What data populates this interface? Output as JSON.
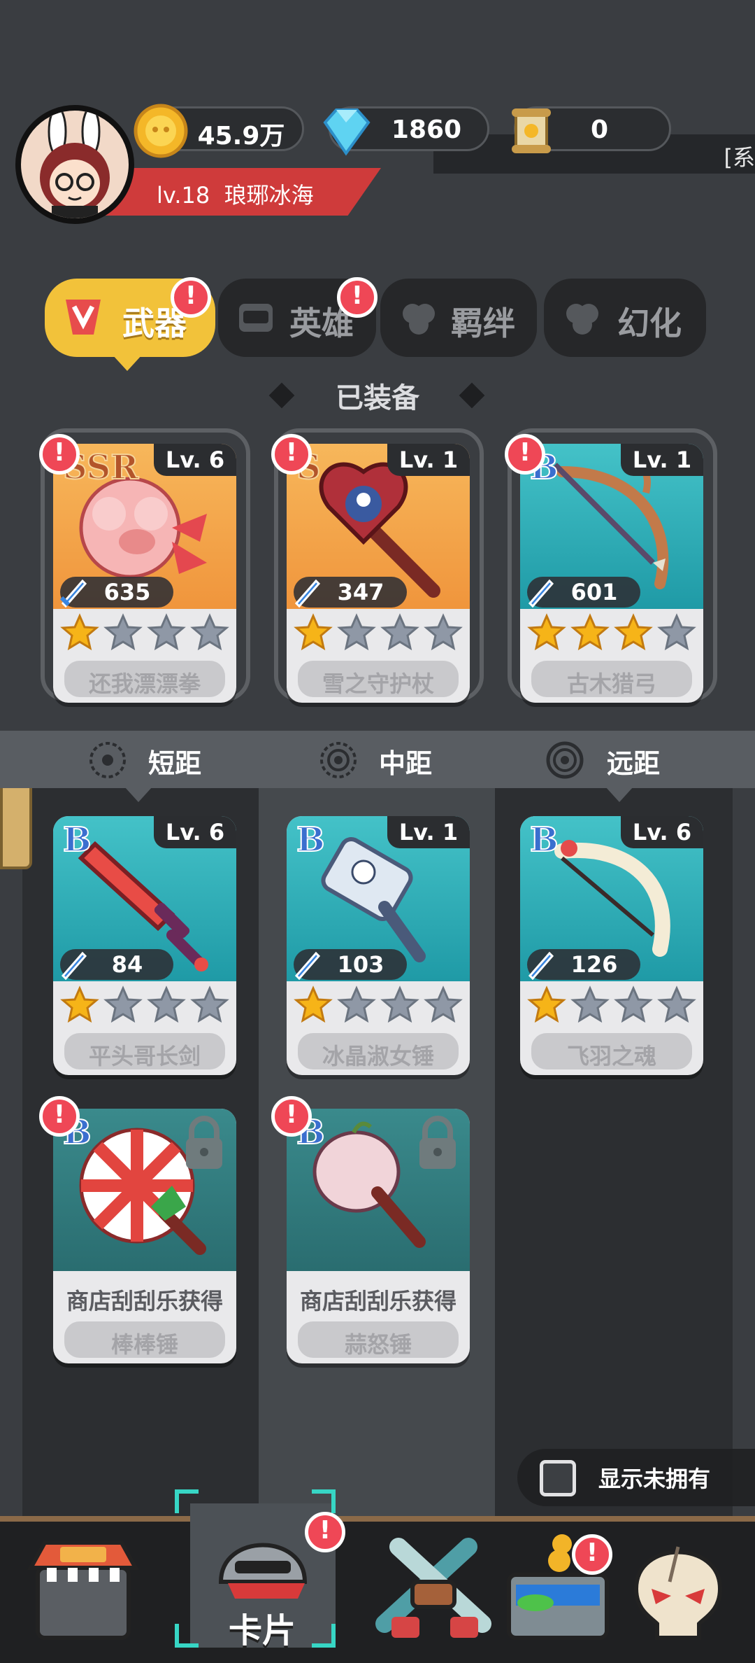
{
  "header": {
    "gold": "45.9万",
    "diamonds": "1860",
    "scrolls": "0",
    "level": "lv.18",
    "player_name": "琅琊冰海",
    "marquee_text": "[系"
  },
  "tabs": [
    {
      "label": "武器",
      "selected": true,
      "badge": true
    },
    {
      "label": "英雄",
      "selected": false,
      "badge": true
    },
    {
      "label": "羁绊",
      "selected": false,
      "badge": false
    },
    {
      "label": "幻化",
      "selected": false,
      "badge": false
    }
  ],
  "equipped_title": "已装备",
  "equipped": [
    {
      "rank": "SSR",
      "level": "Lv. 6",
      "attack": "635",
      "stars": 1,
      "name": "还我漂漂拳",
      "bg": "orange",
      "badge": true
    },
    {
      "rank": "S",
      "level": "Lv. 1",
      "attack": "347",
      "stars": 1,
      "name": "雪之守护杖",
      "bg": "orange",
      "badge": true
    },
    {
      "rank": "B",
      "level": "Lv. 1",
      "attack": "601",
      "stars": 3,
      "name": "古木猎弓",
      "bg": "teal",
      "badge": true
    }
  ],
  "ranges": [
    "短距",
    "中距",
    "远距"
  ],
  "inventory": [
    {
      "rank": "B",
      "level": "Lv. 6",
      "attack": "84",
      "stars": 1,
      "name": "平头哥长剑"
    },
    {
      "rank": "B",
      "level": "Lv. 1",
      "attack": "103",
      "stars": 1,
      "name": "冰晶淑女锤"
    },
    {
      "rank": "B",
      "level": "Lv. 6",
      "attack": "126",
      "stars": 1,
      "name": "飞羽之魂"
    }
  ],
  "locked": [
    {
      "rank": "B",
      "hint": "商店刮刮乐获得",
      "name": "棒棒锤"
    },
    {
      "rank": "B",
      "hint": "商店刮刮乐获得",
      "name": "蒜怒锤"
    }
  ],
  "show_unowned": "显示未拥有",
  "nav": {
    "cards_label": "卡片"
  },
  "colors": {
    "accent_yellow": "#f2c23a",
    "badge_red": "#ef4756",
    "selection_cyan": "#37d6c5"
  }
}
